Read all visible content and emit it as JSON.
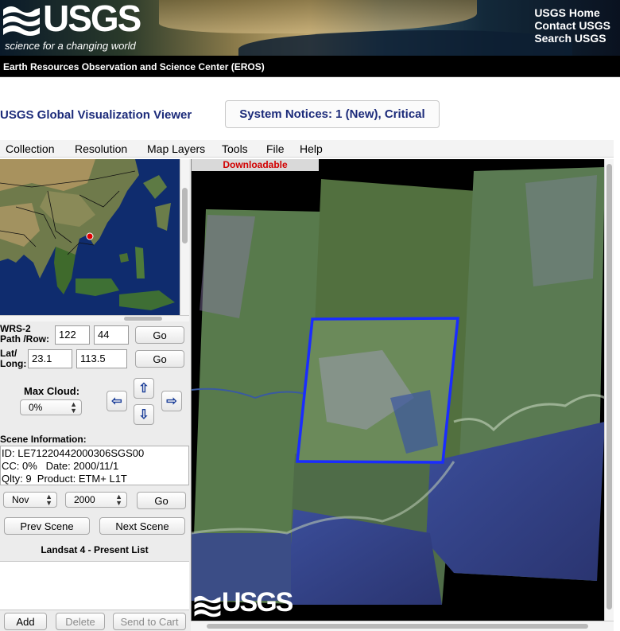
{
  "header": {
    "logo_word": "USGS",
    "tagline": "science for a changing world",
    "links": [
      "USGS Home",
      "Contact USGS",
      "Search USGS"
    ],
    "center_name": "Earth Resources Observation and Science Center (EROS)"
  },
  "app": {
    "title": "USGS Global Visualization Viewer",
    "notices_label": "System Notices: 1 (New), Critical"
  },
  "menu": [
    "Collection",
    "Resolution",
    "Map Layers",
    "Tools",
    "File",
    "Help"
  ],
  "controls": {
    "wrs_label_1": "WRS-2",
    "wrs_label_2": "Path /Row:",
    "path_value": "122",
    "row_value": "44",
    "go_label": "Go",
    "latlong_label_1": "Lat/",
    "latlong_label_2": "Long:",
    "lat_value": "23.1",
    "long_value": "113.5",
    "max_cloud_label": "Max Cloud:",
    "max_cloud_value": "0%",
    "arrows": {
      "up": "⇧",
      "down": "⇩",
      "left": "⇦",
      "right": "⇨"
    }
  },
  "scene": {
    "heading": "Scene Information:",
    "line1": "ID: LE71220442000306SGS00",
    "line2": "CC: 0%   Date: 2000/11/1",
    "line3": "Qlty: 9  Product: ETM+ L1T",
    "month": "Nov",
    "year": "2000",
    "go_label": "Go",
    "prev_label": "Prev Scene",
    "next_label": "Next Scene"
  },
  "list": {
    "heading": "Landsat 4 - Present List",
    "add_label": "Add",
    "delete_label": "Delete",
    "send_label": "Send to Cart"
  },
  "viewer": {
    "status_label": "Downloadable",
    "watermark": "USGS",
    "selection_color": "#1a2cff"
  }
}
